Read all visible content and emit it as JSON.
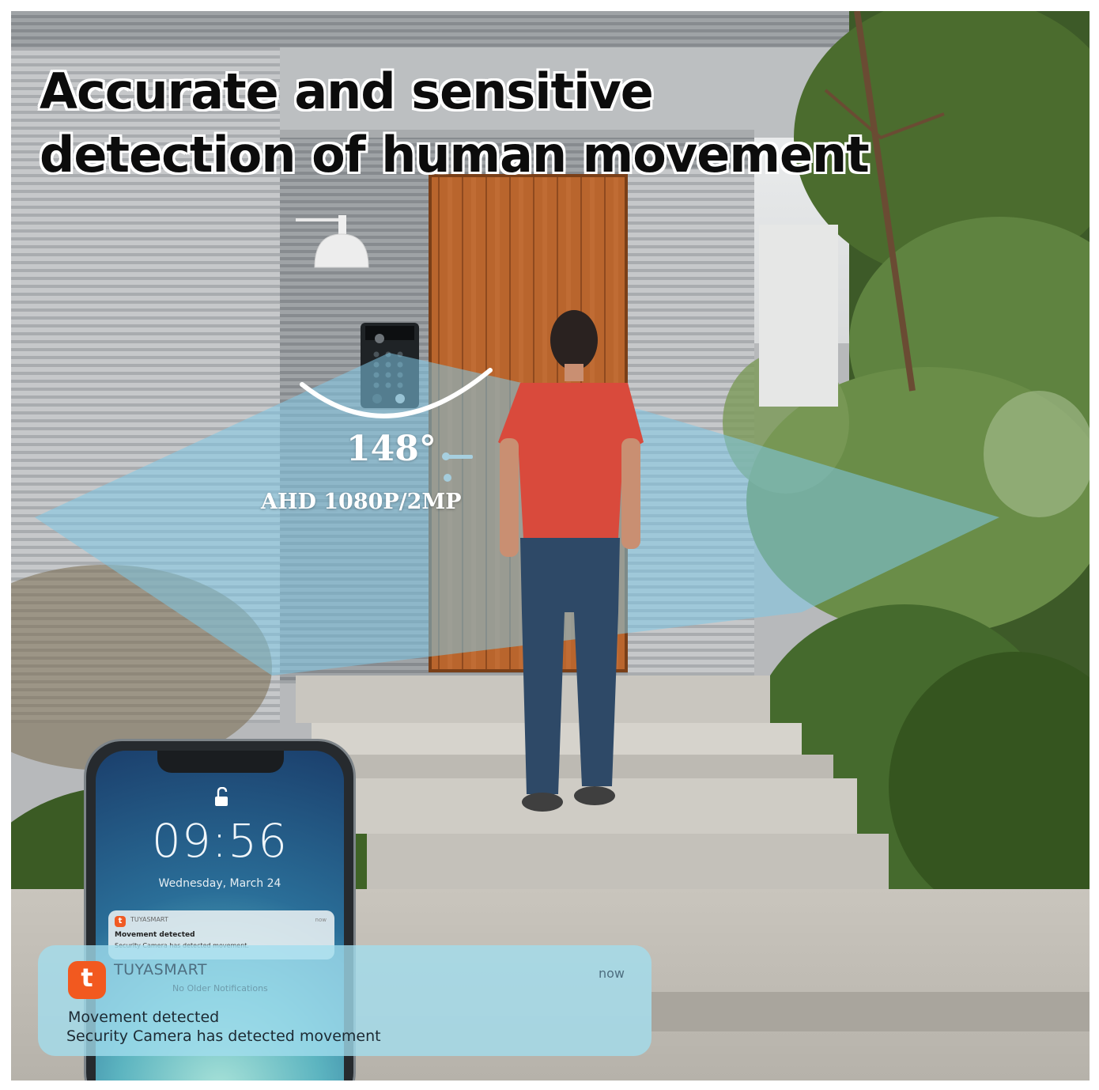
{
  "headline": {
    "line1": "Accurate and sensitive",
    "line2": "detection of human movement"
  },
  "camera": {
    "angle": "148°",
    "resolution": "AHD 1080P/2MP"
  },
  "phone": {
    "time": "09:56",
    "date": "Wednesday, March 24",
    "notification": {
      "app_icon": "t",
      "app": "TUYASMART",
      "time": "now",
      "title": "Movement detected",
      "body": "Security Camera has detected movement."
    }
  },
  "notification": {
    "app_icon": "t",
    "app": "TUYASMART",
    "time": "now",
    "secondary": "No Older Notifications",
    "title": "Movement detected",
    "body": "Security Camera has detected movement"
  },
  "colors": {
    "accent": "#f2591f",
    "detection_beam": "#7fc8e6",
    "door": "#b8622c",
    "shirt": "#d94a3c"
  }
}
